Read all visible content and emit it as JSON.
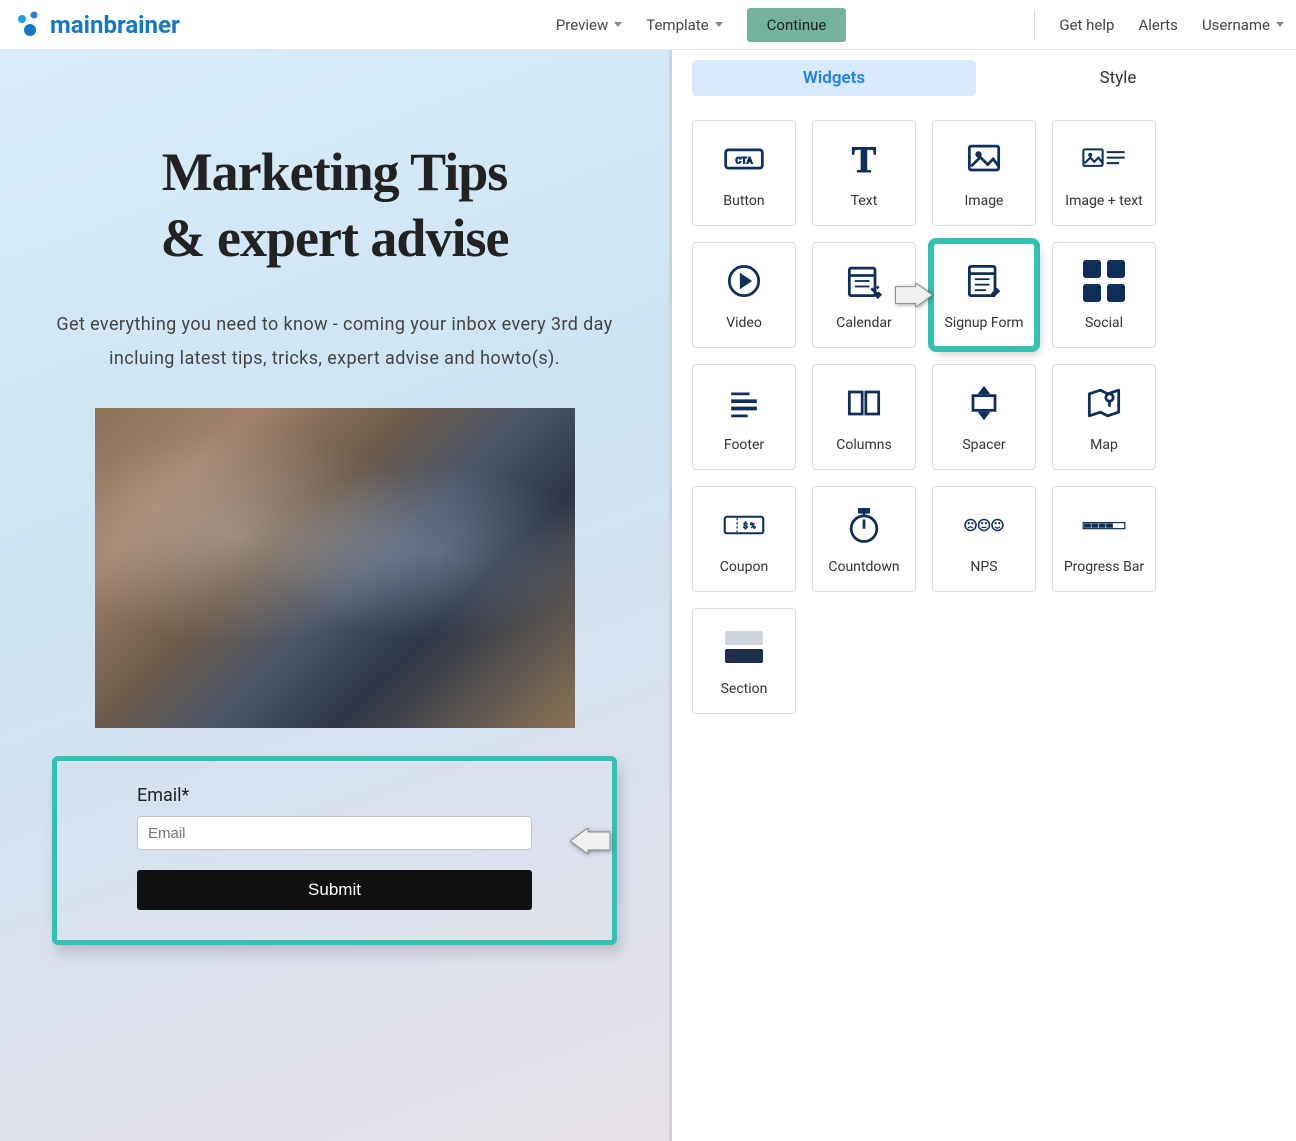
{
  "topbar": {
    "brand": "mainbrainer",
    "preview": "Preview",
    "template": "Template",
    "continue": "Continue",
    "get_help": "Get help",
    "alerts": "Alerts",
    "username": "Username"
  },
  "canvas": {
    "title_line1": "Marketing Tips",
    "title_line2": "& expert advise",
    "subtitle": "Get everything you need to know - coming your inbox every 3rd day incluing latest tips, tricks, expert advise and howto(s).",
    "form": {
      "label": "Email*",
      "placeholder": "Email",
      "submit": "Submit"
    }
  },
  "panel": {
    "tabs": {
      "widgets": "Widgets",
      "style": "Style"
    },
    "widgets": [
      {
        "id": "button",
        "label": "Button"
      },
      {
        "id": "text",
        "label": "Text"
      },
      {
        "id": "image",
        "label": "Image"
      },
      {
        "id": "image-text",
        "label": "Image + text"
      },
      {
        "id": "video",
        "label": "Video"
      },
      {
        "id": "calendar",
        "label": "Calendar"
      },
      {
        "id": "signup-form",
        "label": "Signup Form"
      },
      {
        "id": "social",
        "label": "Social"
      },
      {
        "id": "footer",
        "label": "Footer"
      },
      {
        "id": "columns",
        "label": "Columns"
      },
      {
        "id": "spacer",
        "label": "Spacer"
      },
      {
        "id": "map",
        "label": "Map"
      },
      {
        "id": "coupon",
        "label": "Coupon"
      },
      {
        "id": "countdown",
        "label": "Countdown"
      },
      {
        "id": "nps",
        "label": "NPS"
      },
      {
        "id": "progress-bar",
        "label": "Progress Bar"
      },
      {
        "id": "section",
        "label": "Section"
      }
    ],
    "highlighted": "signup-form"
  }
}
